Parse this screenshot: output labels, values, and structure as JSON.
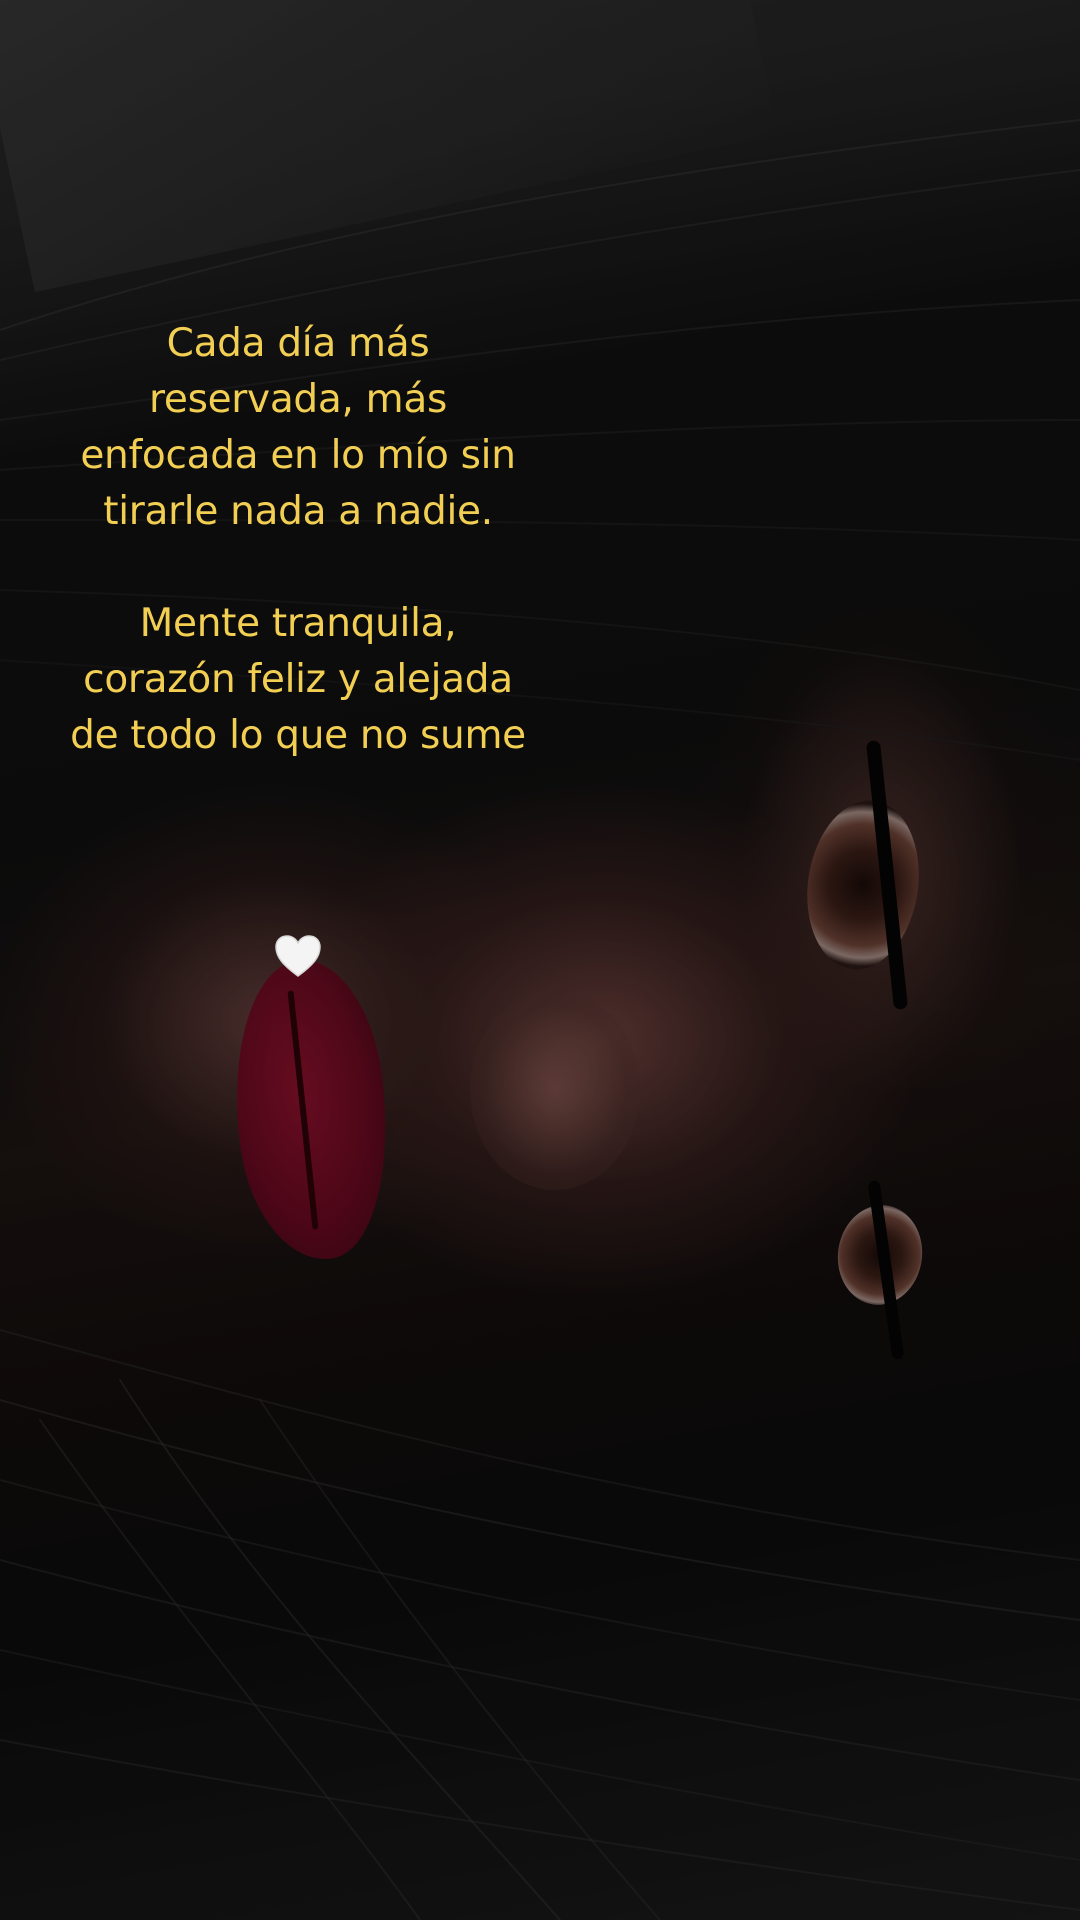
{
  "caption": {
    "paragraph_1": "Cada día más reservada, más enfocada en lo mío sin tirarle nada a nadie.",
    "paragraph_2": "Mente tranquila, corazón feliz y alejada de todo lo que no sume",
    "emoji": "white-heart-icon",
    "text_color": "#f2cf53"
  }
}
